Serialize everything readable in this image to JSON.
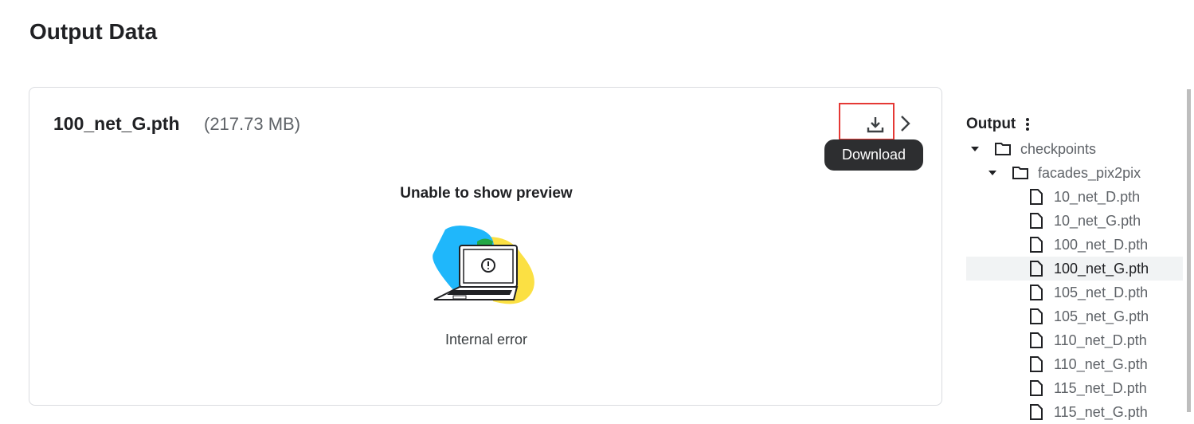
{
  "page_title": "Output Data",
  "file": {
    "name": "100_net_G.pth",
    "size": "(217.73 MB)"
  },
  "download_tooltip": "Download",
  "preview": {
    "title": "Unable to show preview",
    "message": "Internal error"
  },
  "tree": {
    "title": "Output",
    "folders": [
      {
        "name": "checkpoints"
      },
      {
        "name": "facades_pix2pix"
      }
    ],
    "files": [
      {
        "name": "10_net_D.pth"
      },
      {
        "name": "10_net_G.pth"
      },
      {
        "name": "100_net_D.pth"
      },
      {
        "name": "100_net_G.pth",
        "selected": true
      },
      {
        "name": "105_net_D.pth"
      },
      {
        "name": "105_net_G.pth"
      },
      {
        "name": "110_net_D.pth"
      },
      {
        "name": "110_net_G.pth"
      },
      {
        "name": "115_net_D.pth"
      },
      {
        "name": "115_net_G.pth"
      }
    ]
  }
}
